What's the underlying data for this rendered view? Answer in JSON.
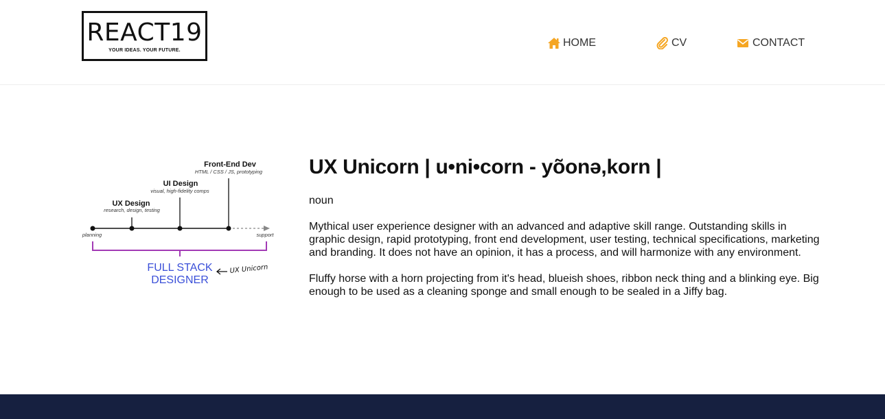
{
  "header": {
    "logo_title": "REACT19",
    "logo_tagline": "YOUR IDEAS. YOUR FUTURE.",
    "nav": [
      {
        "label": "HOME",
        "icon": "home-icon"
      },
      {
        "label": "CV",
        "icon": "paperclip-icon"
      },
      {
        "label": "CONTACT",
        "icon": "envelope-icon"
      }
    ],
    "accent_color": "#f5a623"
  },
  "figure": {
    "stages": [
      {
        "title": "UX Design",
        "subtitle": "research, design, testing"
      },
      {
        "title": "UI Design",
        "subtitle": "visual, high-fidelity comps"
      },
      {
        "title": "Front-End Dev",
        "subtitle": "HTML / CSS / JS, prototyping"
      }
    ],
    "start_label": "planning",
    "end_label": "support",
    "bracket_line1": "FULL STACK",
    "bracket_line2": "DESIGNER",
    "pointer_label": "UX Unicorn",
    "bracket_color": "#a23ab5",
    "label_color": "#3a4fd8"
  },
  "main": {
    "heading": "UX Unicorn | u•ni•corn - yõonə,korn |",
    "part_of_speech": "noun",
    "paragraphs": [
      "Mythical user experience designer with an advanced and adaptive skill range. Outstanding skills in graphic design, rapid prototyping, front end development, user testing, technical specifications, marketing and branding. It does not have an opinion, it has a process, and will harmonize with any environment.",
      "Fluffy horse with a horn projecting from it's head, blueish shoes, ribbon neck thing and a blinking eye. Big enough to be used as a cleaning sponge and small enough to be sealed in a Jiffy bag."
    ]
  },
  "footer": {
    "background": "#162040"
  }
}
